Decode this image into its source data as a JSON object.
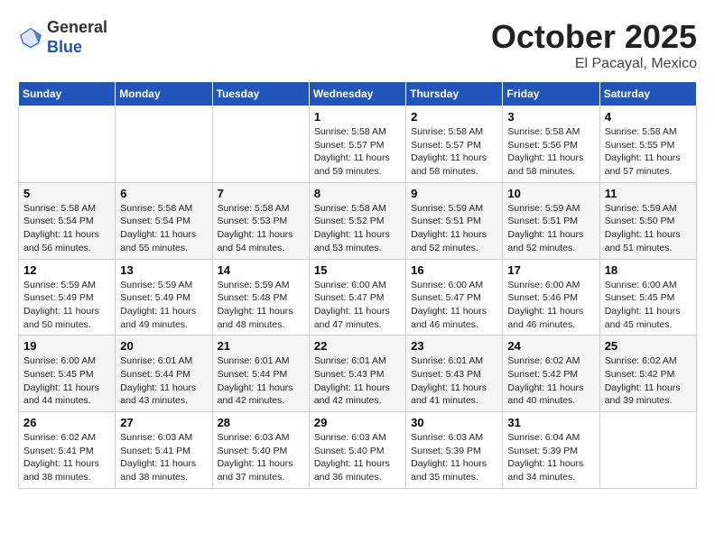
{
  "header": {
    "logo_general": "General",
    "logo_blue": "Blue",
    "month": "October 2025",
    "location": "El Pacayal, Mexico"
  },
  "weekdays": [
    "Sunday",
    "Monday",
    "Tuesday",
    "Wednesday",
    "Thursday",
    "Friday",
    "Saturday"
  ],
  "weeks": [
    [
      {
        "day": "",
        "info": ""
      },
      {
        "day": "",
        "info": ""
      },
      {
        "day": "",
        "info": ""
      },
      {
        "day": "1",
        "info": "Sunrise: 5:58 AM\nSunset: 5:57 PM\nDaylight: 11 hours and 59 minutes."
      },
      {
        "day": "2",
        "info": "Sunrise: 5:58 AM\nSunset: 5:57 PM\nDaylight: 11 hours and 58 minutes."
      },
      {
        "day": "3",
        "info": "Sunrise: 5:58 AM\nSunset: 5:56 PM\nDaylight: 11 hours and 58 minutes."
      },
      {
        "day": "4",
        "info": "Sunrise: 5:58 AM\nSunset: 5:55 PM\nDaylight: 11 hours and 57 minutes."
      }
    ],
    [
      {
        "day": "5",
        "info": "Sunrise: 5:58 AM\nSunset: 5:54 PM\nDaylight: 11 hours and 56 minutes."
      },
      {
        "day": "6",
        "info": "Sunrise: 5:58 AM\nSunset: 5:54 PM\nDaylight: 11 hours and 55 minutes."
      },
      {
        "day": "7",
        "info": "Sunrise: 5:58 AM\nSunset: 5:53 PM\nDaylight: 11 hours and 54 minutes."
      },
      {
        "day": "8",
        "info": "Sunrise: 5:58 AM\nSunset: 5:52 PM\nDaylight: 11 hours and 53 minutes."
      },
      {
        "day": "9",
        "info": "Sunrise: 5:59 AM\nSunset: 5:51 PM\nDaylight: 11 hours and 52 minutes."
      },
      {
        "day": "10",
        "info": "Sunrise: 5:59 AM\nSunset: 5:51 PM\nDaylight: 11 hours and 52 minutes."
      },
      {
        "day": "11",
        "info": "Sunrise: 5:59 AM\nSunset: 5:50 PM\nDaylight: 11 hours and 51 minutes."
      }
    ],
    [
      {
        "day": "12",
        "info": "Sunrise: 5:59 AM\nSunset: 5:49 PM\nDaylight: 11 hours and 50 minutes."
      },
      {
        "day": "13",
        "info": "Sunrise: 5:59 AM\nSunset: 5:49 PM\nDaylight: 11 hours and 49 minutes."
      },
      {
        "day": "14",
        "info": "Sunrise: 5:59 AM\nSunset: 5:48 PM\nDaylight: 11 hours and 48 minutes."
      },
      {
        "day": "15",
        "info": "Sunrise: 6:00 AM\nSunset: 5:47 PM\nDaylight: 11 hours and 47 minutes."
      },
      {
        "day": "16",
        "info": "Sunrise: 6:00 AM\nSunset: 5:47 PM\nDaylight: 11 hours and 46 minutes."
      },
      {
        "day": "17",
        "info": "Sunrise: 6:00 AM\nSunset: 5:46 PM\nDaylight: 11 hours and 46 minutes."
      },
      {
        "day": "18",
        "info": "Sunrise: 6:00 AM\nSunset: 5:45 PM\nDaylight: 11 hours and 45 minutes."
      }
    ],
    [
      {
        "day": "19",
        "info": "Sunrise: 6:00 AM\nSunset: 5:45 PM\nDaylight: 11 hours and 44 minutes."
      },
      {
        "day": "20",
        "info": "Sunrise: 6:01 AM\nSunset: 5:44 PM\nDaylight: 11 hours and 43 minutes."
      },
      {
        "day": "21",
        "info": "Sunrise: 6:01 AM\nSunset: 5:44 PM\nDaylight: 11 hours and 42 minutes."
      },
      {
        "day": "22",
        "info": "Sunrise: 6:01 AM\nSunset: 5:43 PM\nDaylight: 11 hours and 42 minutes."
      },
      {
        "day": "23",
        "info": "Sunrise: 6:01 AM\nSunset: 5:43 PM\nDaylight: 11 hours and 41 minutes."
      },
      {
        "day": "24",
        "info": "Sunrise: 6:02 AM\nSunset: 5:42 PM\nDaylight: 11 hours and 40 minutes."
      },
      {
        "day": "25",
        "info": "Sunrise: 6:02 AM\nSunset: 5:42 PM\nDaylight: 11 hours and 39 minutes."
      }
    ],
    [
      {
        "day": "26",
        "info": "Sunrise: 6:02 AM\nSunset: 5:41 PM\nDaylight: 11 hours and 38 minutes."
      },
      {
        "day": "27",
        "info": "Sunrise: 6:03 AM\nSunset: 5:41 PM\nDaylight: 11 hours and 38 minutes."
      },
      {
        "day": "28",
        "info": "Sunrise: 6:03 AM\nSunset: 5:40 PM\nDaylight: 11 hours and 37 minutes."
      },
      {
        "day": "29",
        "info": "Sunrise: 6:03 AM\nSunset: 5:40 PM\nDaylight: 11 hours and 36 minutes."
      },
      {
        "day": "30",
        "info": "Sunrise: 6:03 AM\nSunset: 5:39 PM\nDaylight: 11 hours and 35 minutes."
      },
      {
        "day": "31",
        "info": "Sunrise: 6:04 AM\nSunset: 5:39 PM\nDaylight: 11 hours and 34 minutes."
      },
      {
        "day": "",
        "info": ""
      }
    ]
  ]
}
